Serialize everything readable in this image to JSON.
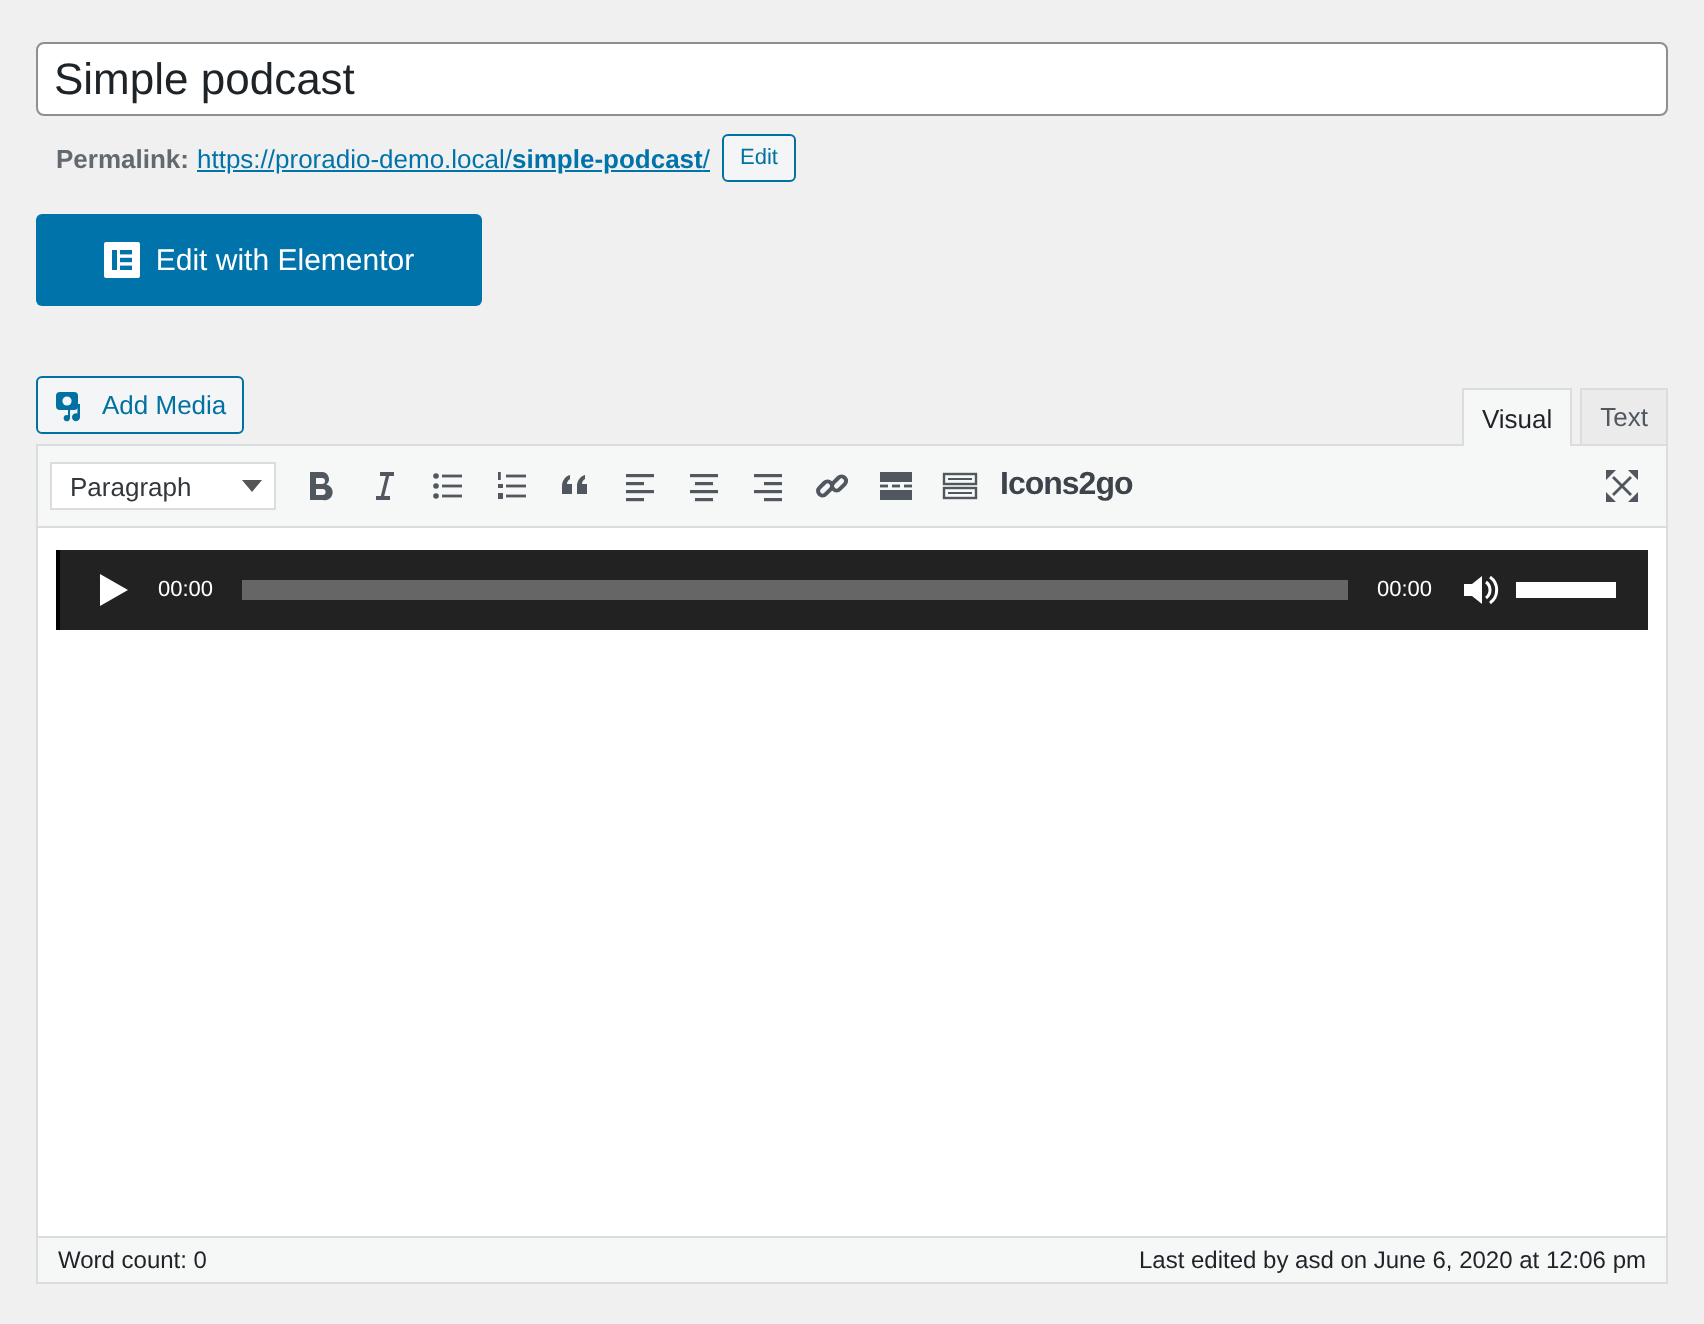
{
  "title_field": {
    "value": "Simple podcast"
  },
  "permalink": {
    "label": "Permalink:",
    "url_base": "https://proradio-demo.local/",
    "slug": "simple-podcast",
    "url_end": "/",
    "edit_button": "Edit"
  },
  "elementor_button": "Edit with Elementor",
  "add_media_button": "Add Media",
  "tabs": [
    {
      "label": "Visual",
      "selected": true
    },
    {
      "label": "Text",
      "selected": false
    }
  ],
  "toolbar": {
    "format_select": "Paragraph",
    "logo": "Icons2go"
  },
  "audio_player": {
    "current_time": "00:00",
    "duration": "00:00",
    "level": 0,
    "volume": {
      "level": 1
    }
  },
  "status_bar": {
    "word_count": "Word count: 0",
    "last_edited": "Last edited by asd on June 6, 2020 at 12:06 pm"
  }
}
